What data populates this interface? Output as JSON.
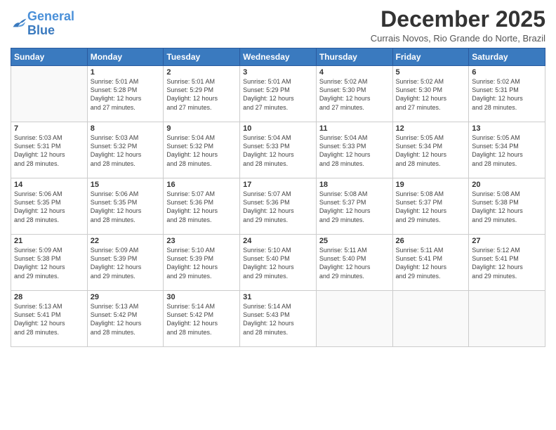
{
  "logo": {
    "text_general": "General",
    "text_blue": "Blue"
  },
  "title": "December 2025",
  "subtitle": "Currais Novos, Rio Grande do Norte, Brazil",
  "header_days": [
    "Sunday",
    "Monday",
    "Tuesday",
    "Wednesday",
    "Thursday",
    "Friday",
    "Saturday"
  ],
  "weeks": [
    [
      {
        "day": "",
        "info": ""
      },
      {
        "day": "1",
        "info": "Sunrise: 5:01 AM\nSunset: 5:28 PM\nDaylight: 12 hours\nand 27 minutes."
      },
      {
        "day": "2",
        "info": "Sunrise: 5:01 AM\nSunset: 5:29 PM\nDaylight: 12 hours\nand 27 minutes."
      },
      {
        "day": "3",
        "info": "Sunrise: 5:01 AM\nSunset: 5:29 PM\nDaylight: 12 hours\nand 27 minutes."
      },
      {
        "day": "4",
        "info": "Sunrise: 5:02 AM\nSunset: 5:30 PM\nDaylight: 12 hours\nand 27 minutes."
      },
      {
        "day": "5",
        "info": "Sunrise: 5:02 AM\nSunset: 5:30 PM\nDaylight: 12 hours\nand 27 minutes."
      },
      {
        "day": "6",
        "info": "Sunrise: 5:02 AM\nSunset: 5:31 PM\nDaylight: 12 hours\nand 28 minutes."
      }
    ],
    [
      {
        "day": "7",
        "info": "Sunrise: 5:03 AM\nSunset: 5:31 PM\nDaylight: 12 hours\nand 28 minutes."
      },
      {
        "day": "8",
        "info": "Sunrise: 5:03 AM\nSunset: 5:32 PM\nDaylight: 12 hours\nand 28 minutes."
      },
      {
        "day": "9",
        "info": "Sunrise: 5:04 AM\nSunset: 5:32 PM\nDaylight: 12 hours\nand 28 minutes."
      },
      {
        "day": "10",
        "info": "Sunrise: 5:04 AM\nSunset: 5:33 PM\nDaylight: 12 hours\nand 28 minutes."
      },
      {
        "day": "11",
        "info": "Sunrise: 5:04 AM\nSunset: 5:33 PM\nDaylight: 12 hours\nand 28 minutes."
      },
      {
        "day": "12",
        "info": "Sunrise: 5:05 AM\nSunset: 5:34 PM\nDaylight: 12 hours\nand 28 minutes."
      },
      {
        "day": "13",
        "info": "Sunrise: 5:05 AM\nSunset: 5:34 PM\nDaylight: 12 hours\nand 28 minutes."
      }
    ],
    [
      {
        "day": "14",
        "info": "Sunrise: 5:06 AM\nSunset: 5:35 PM\nDaylight: 12 hours\nand 28 minutes."
      },
      {
        "day": "15",
        "info": "Sunrise: 5:06 AM\nSunset: 5:35 PM\nDaylight: 12 hours\nand 28 minutes."
      },
      {
        "day": "16",
        "info": "Sunrise: 5:07 AM\nSunset: 5:36 PM\nDaylight: 12 hours\nand 28 minutes."
      },
      {
        "day": "17",
        "info": "Sunrise: 5:07 AM\nSunset: 5:36 PM\nDaylight: 12 hours\nand 29 minutes."
      },
      {
        "day": "18",
        "info": "Sunrise: 5:08 AM\nSunset: 5:37 PM\nDaylight: 12 hours\nand 29 minutes."
      },
      {
        "day": "19",
        "info": "Sunrise: 5:08 AM\nSunset: 5:37 PM\nDaylight: 12 hours\nand 29 minutes."
      },
      {
        "day": "20",
        "info": "Sunrise: 5:08 AM\nSunset: 5:38 PM\nDaylight: 12 hours\nand 29 minutes."
      }
    ],
    [
      {
        "day": "21",
        "info": "Sunrise: 5:09 AM\nSunset: 5:38 PM\nDaylight: 12 hours\nand 29 minutes."
      },
      {
        "day": "22",
        "info": "Sunrise: 5:09 AM\nSunset: 5:39 PM\nDaylight: 12 hours\nand 29 minutes."
      },
      {
        "day": "23",
        "info": "Sunrise: 5:10 AM\nSunset: 5:39 PM\nDaylight: 12 hours\nand 29 minutes."
      },
      {
        "day": "24",
        "info": "Sunrise: 5:10 AM\nSunset: 5:40 PM\nDaylight: 12 hours\nand 29 minutes."
      },
      {
        "day": "25",
        "info": "Sunrise: 5:11 AM\nSunset: 5:40 PM\nDaylight: 12 hours\nand 29 minutes."
      },
      {
        "day": "26",
        "info": "Sunrise: 5:11 AM\nSunset: 5:41 PM\nDaylight: 12 hours\nand 29 minutes."
      },
      {
        "day": "27",
        "info": "Sunrise: 5:12 AM\nSunset: 5:41 PM\nDaylight: 12 hours\nand 29 minutes."
      }
    ],
    [
      {
        "day": "28",
        "info": "Sunrise: 5:13 AM\nSunset: 5:41 PM\nDaylight: 12 hours\nand 28 minutes."
      },
      {
        "day": "29",
        "info": "Sunrise: 5:13 AM\nSunset: 5:42 PM\nDaylight: 12 hours\nand 28 minutes."
      },
      {
        "day": "30",
        "info": "Sunrise: 5:14 AM\nSunset: 5:42 PM\nDaylight: 12 hours\nand 28 minutes."
      },
      {
        "day": "31",
        "info": "Sunrise: 5:14 AM\nSunset: 5:43 PM\nDaylight: 12 hours\nand 28 minutes."
      },
      {
        "day": "",
        "info": ""
      },
      {
        "day": "",
        "info": ""
      },
      {
        "day": "",
        "info": ""
      }
    ]
  ]
}
